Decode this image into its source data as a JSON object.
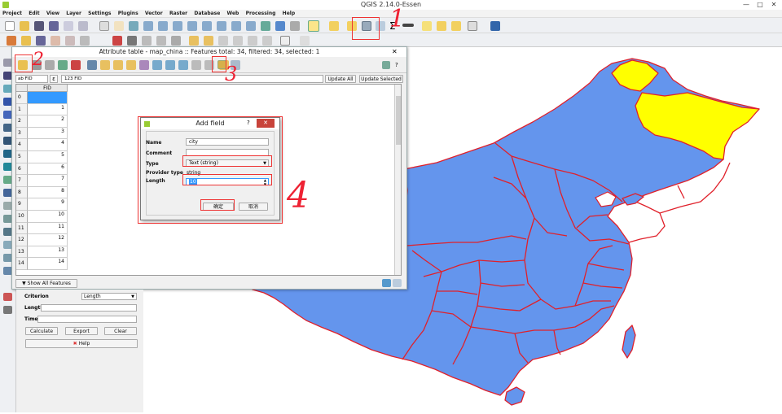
{
  "window": {
    "title": "QGIS 2.14.0-Essen",
    "minimize": "—",
    "maximize": "□",
    "close": "✕"
  },
  "menu": [
    "Project",
    "Edit",
    "View",
    "Layer",
    "Settings",
    "Plugins",
    "Vector",
    "Raster",
    "Database",
    "Web",
    "Processing",
    "Help"
  ],
  "attribute_table": {
    "title": "Attribute table - map_china :: Features total: 34, filtered: 34, selected: 1",
    "field_combo": "ab FID",
    "expr_prefix": "ε",
    "expression": "123 FID",
    "update_all": "Update All",
    "update_selected": "Update Selected",
    "column_header": "FID",
    "rows": [
      {
        "h": "0",
        "v": ""
      },
      {
        "h": "1",
        "v": "1"
      },
      {
        "h": "2",
        "v": "2"
      },
      {
        "h": "3",
        "v": "3"
      },
      {
        "h": "4",
        "v": "4"
      },
      {
        "h": "5",
        "v": "5"
      },
      {
        "h": "6",
        "v": "6"
      },
      {
        "h": "7",
        "v": "7"
      },
      {
        "h": "8",
        "v": "8"
      },
      {
        "h": "9",
        "v": "9"
      },
      {
        "h": "10",
        "v": "10"
      },
      {
        "h": "11",
        "v": "11"
      },
      {
        "h": "12",
        "v": "12"
      },
      {
        "h": "13",
        "v": "13"
      },
      {
        "h": "14",
        "v": "14"
      }
    ],
    "show_all": "Show All Features"
  },
  "add_field": {
    "title": "Add field",
    "help": "?",
    "close": "✕",
    "name_label": "Name",
    "name_value": "city",
    "comment_label": "Comment",
    "comment_value": "",
    "type_label": "Type",
    "type_value": "Text (string)",
    "provider_label": "Provider type",
    "provider_value": "string",
    "length_label": "Length",
    "length_value": "10",
    "ok": "确定",
    "cancel": "取消"
  },
  "bottom_panel": {
    "criterion_label": "Criterion",
    "criterion_value": "Length",
    "length_label": "Length",
    "time_label": "Time",
    "calculate": "Calculate",
    "export": "Export",
    "clear": "Clear",
    "help": "Help"
  },
  "annotations": [
    "1",
    "2",
    "3",
    "4"
  ],
  "colors": {
    "province_fill": "#6495ed",
    "selected_fill": "#ffff00",
    "border": "#e0202a",
    "annotation": "#e02222"
  }
}
